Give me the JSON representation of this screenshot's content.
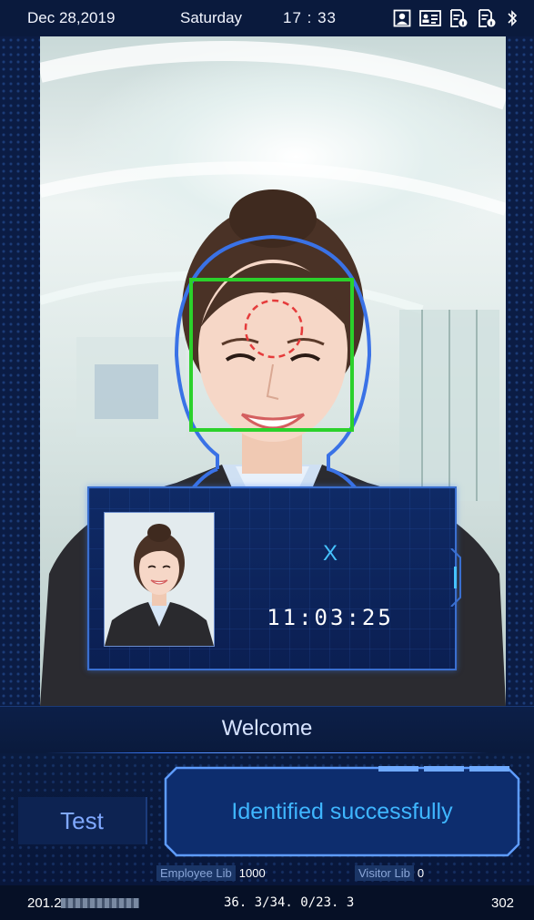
{
  "status": {
    "date": "Dec 28,2019",
    "day": "Saturday",
    "time": "17 : 33",
    "icons": [
      "face-mode-icon",
      "id-card-icon",
      "doc-info-icon-1",
      "doc-info-icon-2",
      "bluetooth-icon"
    ]
  },
  "popup": {
    "name": "X",
    "time": "11:03:25"
  },
  "welcome": "Welcome",
  "test_button": "Test",
  "result": "Identified successfully",
  "libs": {
    "employee_label": "Employee Lib",
    "employee_count": "1000",
    "visitor_label": "Visitor Lib",
    "visitor_count": "0"
  },
  "footer": {
    "ip_prefix": "201.2",
    "temperature": "36. 3/34. 0/23. 3",
    "room": "302"
  },
  "colors": {
    "face_box": "#2bd12b",
    "face_outline": "#3a72e6",
    "forehead_target": "#e53b3b",
    "accent": "#3fb6ff"
  }
}
